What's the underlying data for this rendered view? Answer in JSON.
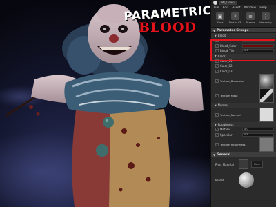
{
  "headline": {
    "line1": "PARAMETRIC",
    "line2": "BLOOD"
  },
  "editor": {
    "tabs": [
      "MI_Clown"
    ],
    "menu": [
      "File",
      "Edit",
      "Asset",
      "Window",
      "Help"
    ],
    "toolbar": [
      {
        "label": "Save",
        "icon": "save-icon"
      },
      {
        "label": "Find in CB",
        "icon": "browse-icon"
      },
      {
        "label": "Params",
        "icon": "params-icon"
      },
      {
        "label": "Hierarchy",
        "icon": "hierarchy-icon"
      }
    ],
    "details": {
      "section_title": "Parameter Groups",
      "blood_group": {
        "title": "Blood",
        "params": [
          {
            "name": "Blood",
            "value": "1.0",
            "checked": true
          },
          {
            "name": "Blood_Color",
            "value": "",
            "checked": true
          },
          {
            "name": "Blood_Tile",
            "value": "0.0",
            "checked": true
          }
        ]
      },
      "color_group": {
        "title": "Color",
        "params": [
          {
            "name": "Color_01",
            "checked": true
          },
          {
            "name": "Color_02",
            "checked": true
          },
          {
            "name": "Color_03",
            "checked": true
          },
          {
            "name": "Texture_Basecolor",
            "checked": true
          },
          {
            "name": "Texture_Mask",
            "checked": true
          }
        ]
      },
      "normal_group": {
        "title": "Normal",
        "params": [
          {
            "name": "Texture_Normal",
            "checked": true
          }
        ]
      },
      "roughness_group": {
        "title": "Roughness",
        "params": [
          {
            "name": "Metallic",
            "value": "0.0",
            "checked": true
          },
          {
            "name": "Specular",
            "value": "0.5",
            "checked": true
          },
          {
            "name": "Texture_Roughness",
            "checked": true
          }
        ]
      },
      "general_group": {
        "title": "General",
        "phys_label": "Phys Material",
        "phys_value": "None",
        "parent_label": "Parent"
      }
    }
  }
}
